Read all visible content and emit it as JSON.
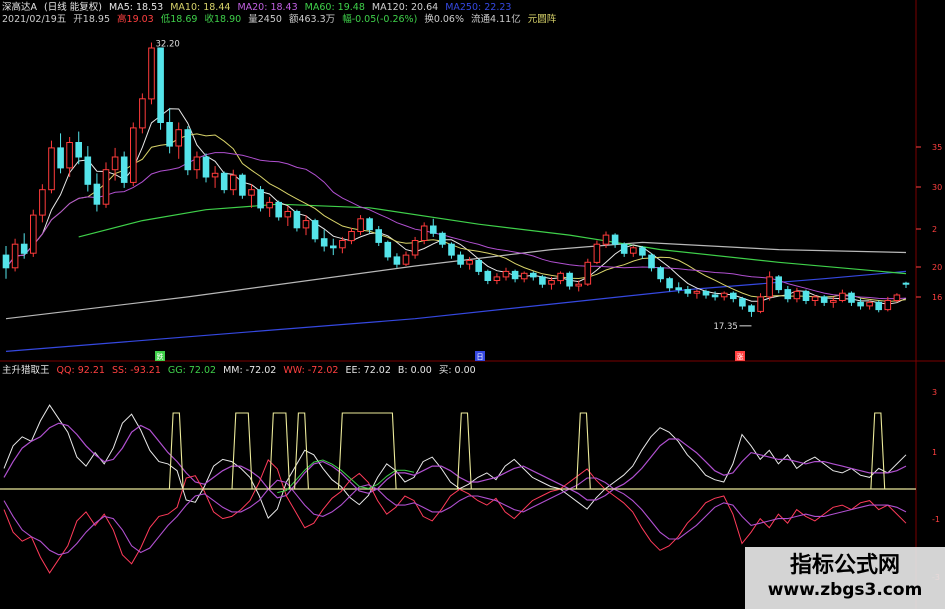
{
  "header": {
    "name": "深高达A",
    "timeframe": "(日线 能复权)",
    "ma5": "MA5: 18.53",
    "ma10": "MA10: 18.44",
    "ma20": "MA20: 18.43",
    "ma60": "MA60: 19.48",
    "ma120": "MA120: 20.64",
    "ma250": "MA250: 22.23",
    "date": "2021/02/19五",
    "open": "开18.95",
    "high": "高19.03",
    "low": "低18.69",
    "close": "收18.90",
    "volume": "量2450",
    "amount": "额463.3万",
    "change": "幅-0.05(-0.26%)",
    "turnover": "换0.06%",
    "float_cap": "流通4.11亿",
    "unit": "元圆阵"
  },
  "indicator_header": {
    "name": "主升猎取王",
    "qq": "QQ: 92.21",
    "ss": "SS: -93.21",
    "gg": "GG: 72.02",
    "mm": "MM: -72.02",
    "ww": "WW: -72.02",
    "ee": "EE: 72.02",
    "b": "B: 0.00",
    "buy": "买: 0.00"
  },
  "annotations": {
    "high_label": "32.20",
    "low_label": "17.35"
  },
  "bottom_markers": [
    "跌",
    "日",
    "涨"
  ],
  "right_axis_top": [
    "35",
    "30",
    "2",
    "20",
    "16"
  ],
  "right_axis_bottom": [
    "3",
    "1",
    "-1",
    "-3"
  ],
  "watermark": {
    "title": "指标公式网",
    "url": "www.zbgs3.com"
  },
  "colors": {
    "up": "#ff3b3b",
    "down": "#55e4ea",
    "ma5": "#e8e8e8",
    "ma10": "#d8d36a",
    "ma20": "#b050d0",
    "ma60": "#3fd04a",
    "ma120": "#b8b8b8",
    "ma250": "#3548e0"
  },
  "chart_data": {
    "type": "candlestick",
    "title": "深高达A (日线 能复权)",
    "candles": [
      {
        "o": 20.5,
        "h": 21.0,
        "l": 19.2,
        "c": 19.8
      },
      {
        "o": 19.8,
        "h": 21.4,
        "l": 19.6,
        "c": 21.1
      },
      {
        "o": 21.1,
        "h": 21.7,
        "l": 20.3,
        "c": 20.6
      },
      {
        "o": 20.6,
        "h": 23.0,
        "l": 20.4,
        "c": 22.7
      },
      {
        "o": 22.7,
        "h": 24.4,
        "l": 22.3,
        "c": 24.1
      },
      {
        "o": 24.1,
        "h": 26.8,
        "l": 23.9,
        "c": 26.4
      },
      {
        "o": 26.4,
        "h": 27.2,
        "l": 25.0,
        "c": 25.3
      },
      {
        "o": 25.3,
        "h": 27.0,
        "l": 24.8,
        "c": 26.7
      },
      {
        "o": 26.7,
        "h": 27.3,
        "l": 25.5,
        "c": 25.9
      },
      {
        "o": 25.9,
        "h": 26.5,
        "l": 24.0,
        "c": 24.4
      },
      {
        "o": 24.4,
        "h": 25.0,
        "l": 22.9,
        "c": 23.3
      },
      {
        "o": 23.3,
        "h": 25.6,
        "l": 23.1,
        "c": 25.2
      },
      {
        "o": 25.2,
        "h": 26.4,
        "l": 24.6,
        "c": 25.9
      },
      {
        "o": 25.9,
        "h": 26.2,
        "l": 24.2,
        "c": 24.5
      },
      {
        "o": 24.5,
        "h": 27.8,
        "l": 24.3,
        "c": 27.5
      },
      {
        "o": 27.5,
        "h": 29.4,
        "l": 27.2,
        "c": 29.1
      },
      {
        "o": 29.1,
        "h": 32.2,
        "l": 28.8,
        "c": 31.9
      },
      {
        "o": 31.9,
        "h": 31.9,
        "l": 27.4,
        "c": 27.8
      },
      {
        "o": 27.8,
        "h": 28.6,
        "l": 26.1,
        "c": 26.5
      },
      {
        "o": 26.5,
        "h": 27.8,
        "l": 25.8,
        "c": 27.4
      },
      {
        "o": 27.4,
        "h": 27.6,
        "l": 24.9,
        "c": 25.2
      },
      {
        "o": 25.2,
        "h": 26.2,
        "l": 24.7,
        "c": 25.9
      },
      {
        "o": 25.9,
        "h": 26.1,
        "l": 24.5,
        "c": 24.8
      },
      {
        "o": 24.8,
        "h": 25.4,
        "l": 24.2,
        "c": 25.0
      },
      {
        "o": 25.0,
        "h": 25.1,
        "l": 23.9,
        "c": 24.1
      },
      {
        "o": 24.1,
        "h": 25.2,
        "l": 23.8,
        "c": 24.9
      },
      {
        "o": 24.9,
        "h": 25.0,
        "l": 23.6,
        "c": 23.8
      },
      {
        "o": 23.8,
        "h": 24.4,
        "l": 23.1,
        "c": 24.1
      },
      {
        "o": 24.1,
        "h": 24.3,
        "l": 22.9,
        "c": 23.1
      },
      {
        "o": 23.1,
        "h": 23.7,
        "l": 22.6,
        "c": 23.4
      },
      {
        "o": 23.4,
        "h": 23.5,
        "l": 22.4,
        "c": 22.6
      },
      {
        "o": 22.6,
        "h": 23.2,
        "l": 22.1,
        "c": 22.9
      },
      {
        "o": 22.9,
        "h": 23.0,
        "l": 21.8,
        "c": 22.0
      },
      {
        "o": 22.0,
        "h": 22.7,
        "l": 21.6,
        "c": 22.4
      },
      {
        "o": 22.4,
        "h": 22.5,
        "l": 21.2,
        "c": 21.4
      },
      {
        "o": 21.4,
        "h": 21.9,
        "l": 20.7,
        "c": 21.0
      },
      {
        "o": 21.0,
        "h": 21.4,
        "l": 20.5,
        "c": 20.9
      },
      {
        "o": 20.9,
        "h": 21.5,
        "l": 20.6,
        "c": 21.3
      },
      {
        "o": 21.3,
        "h": 22.0,
        "l": 21.1,
        "c": 21.8
      },
      {
        "o": 21.8,
        "h": 22.7,
        "l": 21.6,
        "c": 22.5
      },
      {
        "o": 22.5,
        "h": 22.6,
        "l": 21.7,
        "c": 21.9
      },
      {
        "o": 21.9,
        "h": 22.1,
        "l": 21.0,
        "c": 21.2
      },
      {
        "o": 21.2,
        "h": 21.3,
        "l": 20.2,
        "c": 20.4
      },
      {
        "o": 20.4,
        "h": 20.6,
        "l": 19.8,
        "c": 20.0
      },
      {
        "o": 20.0,
        "h": 20.7,
        "l": 19.9,
        "c": 20.5
      },
      {
        "o": 20.5,
        "h": 21.5,
        "l": 20.3,
        "c": 21.3
      },
      {
        "o": 21.3,
        "h": 22.3,
        "l": 21.1,
        "c": 22.1
      },
      {
        "o": 22.1,
        "h": 22.5,
        "l": 21.5,
        "c": 21.7
      },
      {
        "o": 21.7,
        "h": 21.8,
        "l": 20.9,
        "c": 21.1
      },
      {
        "o": 21.1,
        "h": 21.2,
        "l": 20.3,
        "c": 20.5
      },
      {
        "o": 20.5,
        "h": 20.7,
        "l": 19.8,
        "c": 20.0
      },
      {
        "o": 20.0,
        "h": 20.4,
        "l": 19.7,
        "c": 20.2
      },
      {
        "o": 20.2,
        "h": 20.3,
        "l": 19.4,
        "c": 19.6
      },
      {
        "o": 19.6,
        "h": 19.7,
        "l": 18.9,
        "c": 19.1
      },
      {
        "o": 19.1,
        "h": 19.5,
        "l": 18.9,
        "c": 19.3
      },
      {
        "o": 19.3,
        "h": 19.8,
        "l": 19.1,
        "c": 19.6
      },
      {
        "o": 19.6,
        "h": 19.7,
        "l": 19.0,
        "c": 19.2
      },
      {
        "o": 19.2,
        "h": 19.6,
        "l": 19.0,
        "c": 19.5
      },
      {
        "o": 19.5,
        "h": 19.6,
        "l": 19.1,
        "c": 19.3
      },
      {
        "o": 19.3,
        "h": 19.4,
        "l": 18.7,
        "c": 18.9
      },
      {
        "o": 18.9,
        "h": 19.3,
        "l": 18.6,
        "c": 19.1
      },
      {
        "o": 19.1,
        "h": 19.6,
        "l": 18.9,
        "c": 19.5
      },
      {
        "o": 19.5,
        "h": 19.6,
        "l": 18.6,
        "c": 18.8
      },
      {
        "o": 18.8,
        "h": 19.1,
        "l": 18.5,
        "c": 18.9
      },
      {
        "o": 18.9,
        "h": 20.3,
        "l": 18.8,
        "c": 20.1
      },
      {
        "o": 20.1,
        "h": 21.3,
        "l": 20.0,
        "c": 21.1
      },
      {
        "o": 21.1,
        "h": 21.8,
        "l": 20.9,
        "c": 21.6
      },
      {
        "o": 21.6,
        "h": 21.7,
        "l": 20.9,
        "c": 21.1
      },
      {
        "o": 21.1,
        "h": 21.2,
        "l": 20.4,
        "c": 20.6
      },
      {
        "o": 20.6,
        "h": 21.0,
        "l": 20.4,
        "c": 20.9
      },
      {
        "o": 20.9,
        "h": 21.0,
        "l": 20.3,
        "c": 20.5
      },
      {
        "o": 20.5,
        "h": 20.6,
        "l": 19.6,
        "c": 19.8
      },
      {
        "o": 19.8,
        "h": 19.9,
        "l": 19.0,
        "c": 19.2
      },
      {
        "o": 19.2,
        "h": 19.3,
        "l": 18.5,
        "c": 18.7
      },
      {
        "o": 18.7,
        "h": 19.0,
        "l": 18.4,
        "c": 18.6
      },
      {
        "o": 18.6,
        "h": 18.8,
        "l": 18.2,
        "c": 18.4
      },
      {
        "o": 18.4,
        "h": 18.6,
        "l": 18.1,
        "c": 18.5
      },
      {
        "o": 18.5,
        "h": 18.6,
        "l": 18.1,
        "c": 18.3
      },
      {
        "o": 18.3,
        "h": 18.5,
        "l": 18.0,
        "c": 18.2
      },
      {
        "o": 18.2,
        "h": 18.5,
        "l": 18.0,
        "c": 18.4
      },
      {
        "o": 18.4,
        "h": 18.5,
        "l": 17.9,
        "c": 18.1
      },
      {
        "o": 18.1,
        "h": 18.2,
        "l": 17.5,
        "c": 17.7
      },
      {
        "o": 17.7,
        "h": 17.8,
        "l": 17.1,
        "c": 17.4
      },
      {
        "o": 17.4,
        "h": 18.4,
        "l": 17.3,
        "c": 18.2
      },
      {
        "o": 18.2,
        "h": 19.6,
        "l": 18.0,
        "c": 19.3
      },
      {
        "o": 19.3,
        "h": 19.4,
        "l": 18.4,
        "c": 18.6
      },
      {
        "o": 18.6,
        "h": 18.8,
        "l": 17.9,
        "c": 18.1
      },
      {
        "o": 18.1,
        "h": 18.7,
        "l": 17.9,
        "c": 18.5
      },
      {
        "o": 18.5,
        "h": 18.6,
        "l": 17.8,
        "c": 18.0
      },
      {
        "o": 18.0,
        "h": 18.3,
        "l": 17.7,
        "c": 18.2
      },
      {
        "o": 18.2,
        "h": 18.3,
        "l": 17.7,
        "c": 17.9
      },
      {
        "o": 17.9,
        "h": 18.2,
        "l": 17.6,
        "c": 18.0
      },
      {
        "o": 18.0,
        "h": 18.6,
        "l": 17.9,
        "c": 18.4
      },
      {
        "o": 18.4,
        "h": 18.5,
        "l": 17.7,
        "c": 17.9
      },
      {
        "o": 17.9,
        "h": 18.1,
        "l": 17.5,
        "c": 17.7
      },
      {
        "o": 17.7,
        "h": 18.0,
        "l": 17.5,
        "c": 17.9
      },
      {
        "o": 17.9,
        "h": 18.0,
        "l": 17.35,
        "c": 17.5
      },
      {
        "o": 17.5,
        "h": 18.2,
        "l": 17.4,
        "c": 18.0
      },
      {
        "o": 18.0,
        "h": 18.4,
        "l": 17.9,
        "c": 18.3
      },
      {
        "o": 18.95,
        "h": 19.03,
        "l": 18.69,
        "c": 18.9
      }
    ],
    "ma_lines": [
      {
        "name": "MA120",
        "values": [
          [
            0,
            17.0
          ],
          [
            20,
            18.2
          ],
          [
            45,
            19.9
          ],
          [
            60,
            20.8
          ],
          [
            70,
            21.2
          ],
          [
            85,
            20.8
          ],
          [
            99,
            20.64
          ]
        ]
      },
      {
        "name": "MA250",
        "values": [
          [
            0,
            15.2
          ],
          [
            20,
            16.0
          ],
          [
            45,
            17.0
          ],
          [
            60,
            17.8
          ],
          [
            75,
            18.6
          ],
          [
            90,
            19.2
          ],
          [
            99,
            19.6
          ]
        ]
      },
      {
        "name": "MA60",
        "values": [
          [
            8,
            21.5
          ],
          [
            15,
            22.4
          ],
          [
            22,
            23.0
          ],
          [
            30,
            23.3
          ],
          [
            40,
            23.1
          ],
          [
            52,
            22.2
          ],
          [
            62,
            21.6
          ],
          [
            72,
            20.8
          ],
          [
            85,
            20.1
          ],
          [
            99,
            19.48
          ]
        ]
      }
    ],
    "ylim": [
      15,
      33
    ]
  },
  "indicator_data": {
    "ylim": [
      -5,
      5
    ],
    "wave1": [
      1.0,
      2.0,
      2.4,
      2.2,
      3.1,
      3.8,
      3.2,
      2.6,
      1.5,
      1.1,
      1.7,
      1.2,
      1.9,
      3.0,
      3.4,
      2.7,
      1.8,
      1.3,
      1.2,
      0.9,
      -0.4,
      -0.5,
      0.2,
      1.1,
      1.4,
      1.3,
      1.0,
      0.6,
      -0.2,
      -1.2,
      -0.8,
      0.4,
      1.1,
      1.8,
      1.6,
      1.0,
      0.5,
      0.2,
      -0.3,
      -0.6,
      -0.2,
      0.6,
      1.2,
      0.9,
      0.4,
      0.6,
      1.3,
      1.5,
      1.0,
      0.4,
      0.1,
      0.3,
      0.6,
      0.8,
      0.5,
      1.1,
      1.4,
      1.0,
      0.6,
      0.4,
      0.2,
      0.1,
      -0.2,
      -0.5,
      -0.8,
      -0.3,
      0.1,
      0.4,
      0.7,
      1.1,
      1.8,
      2.4,
      2.8,
      2.6,
      2.2,
      1.6,
      1.2,
      0.7,
      0.5,
      0.4,
      1.2,
      2.5,
      2.0,
      1.4,
      1.8,
      1.2,
      1.6,
      1.0,
      1.3,
      1.5,
      1.2,
      0.9,
      0.8,
      1.0,
      0.7,
      0.6,
      1.0,
      0.8,
      1.2,
      1.6
    ],
    "wave2": [
      0.6,
      1.3,
      1.9,
      2.2,
      2.4,
      2.8,
      3.0,
      2.9,
      2.5,
      2.0,
      1.6,
      1.3,
      1.4,
      1.9,
      2.6,
      2.9,
      2.7,
      2.2,
      1.7,
      1.3,
      0.8,
      0.4,
      0.3,
      0.6,
      0.9,
      1.1,
      1.1,
      0.9,
      0.6,
      0.1,
      -0.3,
      -0.2,
      0.3,
      0.8,
      1.2,
      1.3,
      1.1,
      0.8,
      0.4,
      0.0,
      -0.1,
      0.1,
      0.5,
      0.8,
      0.8,
      0.7,
      0.9,
      1.1,
      1.1,
      0.9,
      0.6,
      0.4,
      0.4,
      0.5,
      0.6,
      0.8,
      1.0,
      1.1,
      0.9,
      0.7,
      0.5,
      0.3,
      0.1,
      -0.1,
      -0.4,
      -0.4,
      -0.2,
      0.1,
      0.3,
      0.6,
      1.0,
      1.5,
      2.0,
      2.3,
      2.3,
      2.0,
      1.7,
      1.3,
      0.9,
      0.7,
      0.8,
      1.3,
      1.7,
      1.6,
      1.5,
      1.4,
      1.4,
      1.3,
      1.2,
      1.3,
      1.3,
      1.2,
      1.1,
      1.0,
      0.9,
      0.8,
      0.8,
      0.8,
      0.9,
      1.1
    ],
    "spike_segments": [
      [
        27,
        28
      ],
      [
        37,
        39
      ],
      [
        43,
        45
      ],
      [
        47,
        48
      ],
      [
        54,
        62
      ],
      [
        73,
        74
      ],
      [
        92,
        93
      ],
      [
        139,
        140
      ]
    ],
    "note": "spike line is at top level during segment indices (in an x-grid of 145 steps), baseline otherwise"
  }
}
